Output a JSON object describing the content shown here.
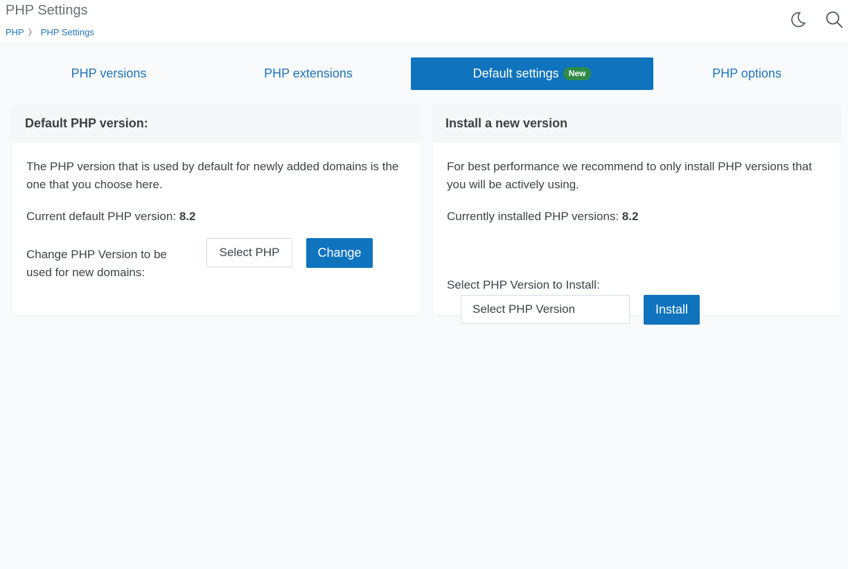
{
  "header": {
    "title": "PHP Settings",
    "breadcrumb": [
      "PHP",
      "PHP Settings"
    ]
  },
  "icons": {
    "theme": "moon-icon",
    "search": "search-icon"
  },
  "tabs": [
    {
      "label": "PHP versions"
    },
    {
      "label": "PHP extensions"
    },
    {
      "label": "Default settings",
      "badge": "New",
      "active": true
    },
    {
      "label": "PHP options"
    }
  ],
  "default_card": {
    "title": "Default PHP version:",
    "description": "The PHP version that is used by default for newly added domains is the one that you choose here.",
    "current_label": "Current default PHP version:",
    "current_value": "8.2",
    "change_label": "Change PHP Version to be used for new domains:",
    "select_label": "Select PHP",
    "change_button": "Change"
  },
  "install_card": {
    "title": "Install a new version",
    "description": "For best performance we recommend to only install PHP versions that you will be actively using.",
    "installed_label": "Currently installed PHP versions:",
    "installed_value": "8.2",
    "install_label": "Select PHP Version to Install:",
    "select_placeholder": "Select PHP Version",
    "install_button": "Install"
  },
  "colors": {
    "accent": "#0f73bd",
    "badge": "#2f8a48",
    "link": "#1f74b8"
  }
}
